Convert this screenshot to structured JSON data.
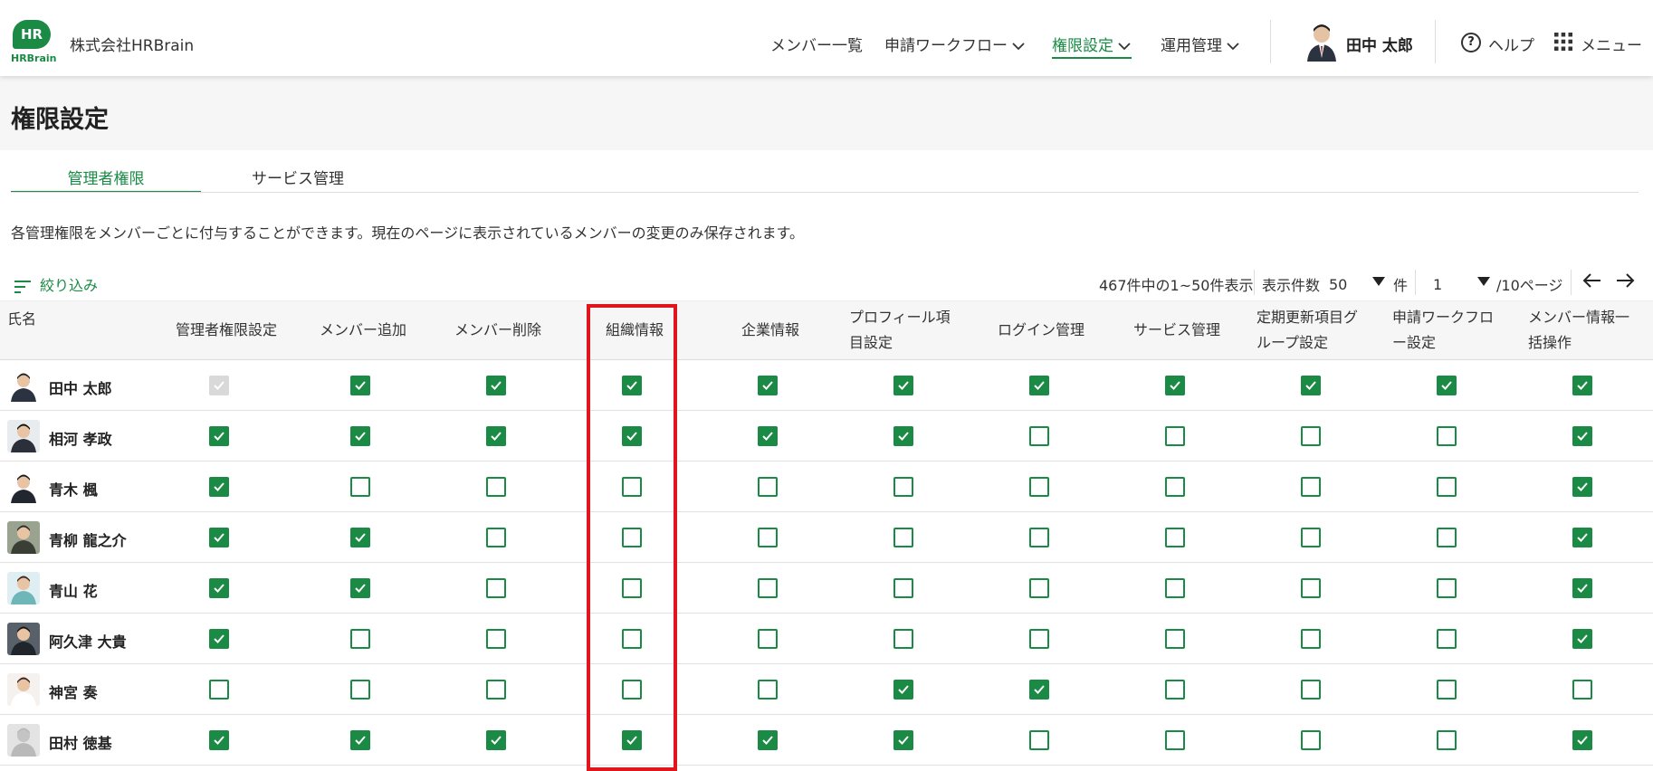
{
  "company": "株式会社HRBrain",
  "logo_text": "HR",
  "logo_word": "HRBrain",
  "nav": {
    "members": "メンバー一覧",
    "workflow": "申請ワークフロー",
    "permissions": "権限設定",
    "operations": "運用管理",
    "user": "田中 太郎",
    "help": "ヘルプ",
    "menu": "メニュー"
  },
  "page_title": "権限設定",
  "tabs": [
    "管理者権限",
    "サービス管理"
  ],
  "description": "各管理権限をメンバーごとに付与することができます。現在のページに表示されているメンバーの変更のみ保存されます。",
  "filter_label": "絞り込み",
  "pagination": {
    "summary": "467件中の1~50件表示",
    "per_page_label": "表示件数",
    "per_page": "50",
    "per_page_unit": "件",
    "page": "1",
    "page_total": "/10ページ"
  },
  "columns": {
    "name": "氏名",
    "list": [
      [
        "管理者権限設定"
      ],
      [
        "メンバー追加"
      ],
      [
        "メンバー削除"
      ],
      [
        "組織情報"
      ],
      [
        "企業情報"
      ],
      [
        "プロフィール項",
        "目設定"
      ],
      [
        "ログイン管理"
      ],
      [
        "サービス管理"
      ],
      [
        "定期更新項目グ",
        "ループ設定"
      ],
      [
        "申請ワークフロ",
        "ー設定"
      ],
      [
        "メンバー情報一",
        "括操作"
      ]
    ]
  },
  "rows": [
    {
      "name": "田中 太郎",
      "perms": [
        "disabled",
        "on",
        "on",
        "on",
        "on",
        "on",
        "on",
        "on",
        "on",
        "on",
        "on"
      ]
    },
    {
      "name": "相河 孝政",
      "perms": [
        "on",
        "on",
        "on",
        "on",
        "on",
        "on",
        "off",
        "off",
        "off",
        "off",
        "on"
      ]
    },
    {
      "name": "青木 楓",
      "perms": [
        "on",
        "off",
        "off",
        "off",
        "off",
        "off",
        "off",
        "off",
        "off",
        "off",
        "on"
      ]
    },
    {
      "name": "青柳 龍之介",
      "perms": [
        "on",
        "on",
        "off",
        "off",
        "off",
        "off",
        "off",
        "off",
        "off",
        "off",
        "on"
      ]
    },
    {
      "name": "青山 花",
      "perms": [
        "on",
        "on",
        "off",
        "off",
        "off",
        "off",
        "off",
        "off",
        "off",
        "off",
        "on"
      ]
    },
    {
      "name": "阿久津 大貴",
      "perms": [
        "on",
        "off",
        "off",
        "off",
        "off",
        "off",
        "off",
        "off",
        "off",
        "off",
        "on"
      ]
    },
    {
      "name": "神宮 奏",
      "perms": [
        "off",
        "off",
        "off",
        "off",
        "off",
        "on",
        "on",
        "off",
        "off",
        "off",
        "off"
      ]
    },
    {
      "name": "田村 徳基",
      "perms": [
        "on",
        "on",
        "on",
        "on",
        "on",
        "on",
        "off",
        "off",
        "off",
        "off",
        "on"
      ]
    }
  ],
  "colors": {
    "accent": "#1a8a45",
    "highlight": "#e0161c"
  }
}
